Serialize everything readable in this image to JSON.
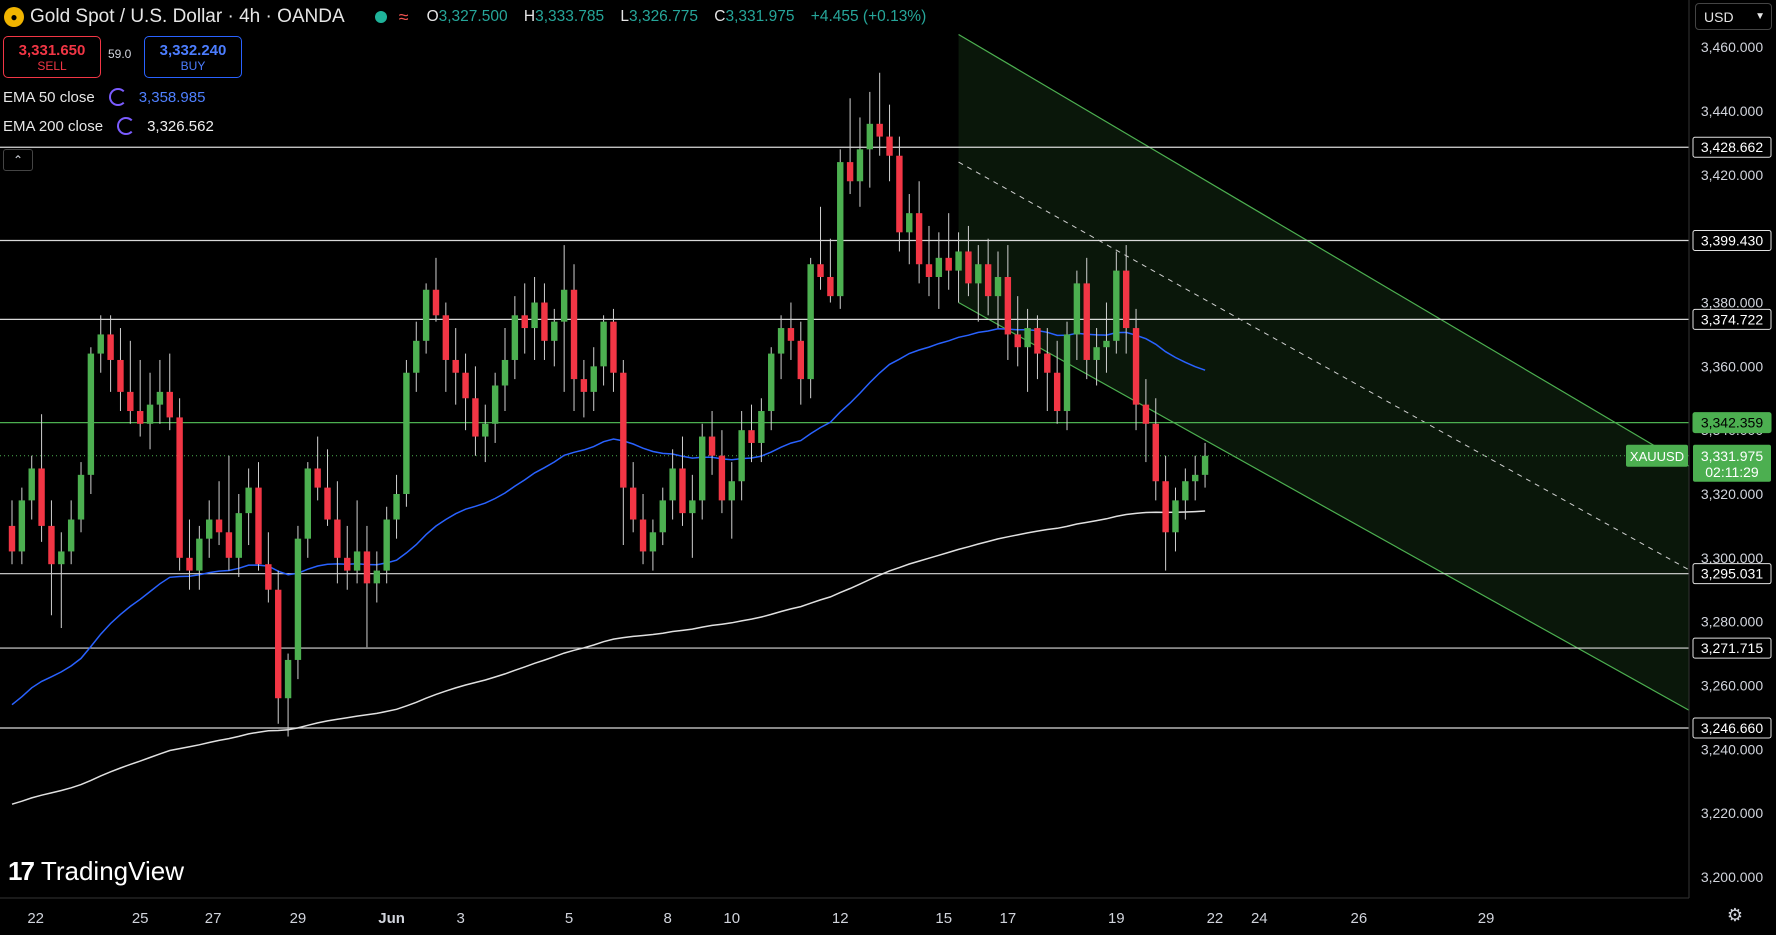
{
  "header": {
    "title": "Gold Spot / U.S. Dollar · 4h · OANDA",
    "ohlc": [
      {
        "key": "O",
        "value": "3,327.500"
      },
      {
        "key": "H",
        "value": "3,333.785"
      },
      {
        "key": "L",
        "value": "3,326.775"
      },
      {
        "key": "C",
        "value": "3,331.975"
      }
    ],
    "change": "+4.455 (+0.13%)"
  },
  "trade": {
    "sell_price": "3,331.650",
    "sell_label": "SELL",
    "spread": "59.0",
    "buy_price": "3,332.240",
    "buy_label": "BUY"
  },
  "indicators": [
    {
      "label": "EMA 50 close",
      "value": "3,358.985",
      "color": "#2962ff"
    },
    {
      "label": "EMA 200 close",
      "value": "3,326.562",
      "color": "#ffffff"
    }
  ],
  "currency": "USD",
  "brand": "TradingView",
  "colors": {
    "up": "#4caf50",
    "down": "#f23645",
    "channel": "#4caf50",
    "ema50": "#2962ff",
    "ema200": "#e0e0e0"
  },
  "chart_data": {
    "type": "candlestick",
    "ylim": [
      3193.4,
      3474.8
    ],
    "yticks": [
      "3,200.000",
      "3,220.000",
      "3,240.000",
      "3,260.000",
      "3,280.000",
      "3,300.000",
      "3,320.000",
      "3,340.000",
      "3,360.000",
      "3,380.000",
      "3,400.000",
      "3,420.000",
      "3,440.000",
      "3,460.000"
    ],
    "xticks": [
      "22",
      "25",
      "27",
      "29",
      "Jun",
      "3",
      "5",
      "8",
      "10",
      "12",
      "15",
      "17",
      "19",
      "22",
      "24",
      "26",
      "29"
    ],
    "horizontal_levels": [
      {
        "label": "3,428.662",
        "value": 3428.662
      },
      {
        "label": "3,399.430",
        "value": 3399.43
      },
      {
        "label": "3,374.722",
        "value": 3374.722
      },
      {
        "label": "3,342.359",
        "value": 3342.359,
        "highlight": true
      },
      {
        "label": "3,295.031",
        "value": 3295.031
      },
      {
        "label": "3,271.715",
        "value": 3271.715
      },
      {
        "label": "3,246.660",
        "value": 3246.66
      }
    ],
    "current_price": {
      "symbol": "XAUUSD",
      "value": 3331.975,
      "label": "3,331.975",
      "countdown": "02:11:29"
    },
    "channel": {
      "start_index": 96,
      "end_index": 165,
      "upper": [
        3464,
        3338
      ],
      "mid": [
        3424,
        3305
      ],
      "lower": [
        3380,
        3261
      ]
    },
    "candles": [
      [
        3310,
        3318,
        3298,
        3302
      ],
      [
        3302,
        3322,
        3298,
        3318
      ],
      [
        3318,
        3332,
        3312,
        3328
      ],
      [
        3328,
        3345,
        3305,
        3310
      ],
      [
        3310,
        3318,
        3282,
        3298
      ],
      [
        3298,
        3308,
        3278,
        3302
      ],
      [
        3302,
        3318,
        3298,
        3312
      ],
      [
        3312,
        3330,
        3308,
        3326
      ],
      [
        3326,
        3366,
        3320,
        3364
      ],
      [
        3364,
        3376,
        3358,
        3370
      ],
      [
        3370,
        3376,
        3352,
        3362
      ],
      [
        3362,
        3372,
        3346,
        3352
      ],
      [
        3352,
        3368,
        3342,
        3346
      ],
      [
        3346,
        3362,
        3338,
        3342
      ],
      [
        3342,
        3358,
        3334,
        3348
      ],
      [
        3348,
        3362,
        3342,
        3352
      ],
      [
        3352,
        3364,
        3340,
        3344
      ],
      [
        3344,
        3350,
        3296,
        3300
      ],
      [
        3300,
        3312,
        3290,
        3296
      ],
      [
        3296,
        3310,
        3290,
        3306
      ],
      [
        3306,
        3318,
        3300,
        3312
      ],
      [
        3312,
        3324,
        3304,
        3308
      ],
      [
        3308,
        3332,
        3296,
        3300
      ],
      [
        3300,
        3320,
        3294,
        3314
      ],
      [
        3314,
        3328,
        3304,
        3322
      ],
      [
        3322,
        3330,
        3296,
        3298
      ],
      [
        3298,
        3308,
        3286,
        3290
      ],
      [
        3290,
        3296,
        3248,
        3256
      ],
      [
        3256,
        3270,
        3244,
        3268
      ],
      [
        3268,
        3310,
        3262,
        3306
      ],
      [
        3306,
        3330,
        3300,
        3328
      ],
      [
        3328,
        3338,
        3318,
        3322
      ],
      [
        3322,
        3334,
        3310,
        3312
      ],
      [
        3312,
        3324,
        3292,
        3300
      ],
      [
        3300,
        3310,
        3290,
        3296
      ],
      [
        3296,
        3318,
        3292,
        3302
      ],
      [
        3302,
        3310,
        3272,
        3292
      ],
      [
        3292,
        3302,
        3286,
        3296
      ],
      [
        3296,
        3316,
        3292,
        3312
      ],
      [
        3312,
        3326,
        3306,
        3320
      ],
      [
        3320,
        3362,
        3316,
        3358
      ],
      [
        3358,
        3374,
        3352,
        3368
      ],
      [
        3368,
        3386,
        3364,
        3384
      ],
      [
        3384,
        3394,
        3374,
        3376
      ],
      [
        3376,
        3380,
        3352,
        3362
      ],
      [
        3362,
        3372,
        3348,
        3358
      ],
      [
        3358,
        3364,
        3340,
        3350
      ],
      [
        3350,
        3360,
        3332,
        3338
      ],
      [
        3338,
        3348,
        3330,
        3342
      ],
      [
        3342,
        3358,
        3336,
        3354
      ],
      [
        3354,
        3372,
        3346,
        3362
      ],
      [
        3362,
        3382,
        3356,
        3376
      ],
      [
        3376,
        3386,
        3364,
        3372
      ],
      [
        3372,
        3388,
        3362,
        3380
      ],
      [
        3380,
        3386,
        3362,
        3368
      ],
      [
        3368,
        3378,
        3360,
        3374
      ],
      [
        3374,
        3398,
        3352,
        3384
      ],
      [
        3384,
        3392,
        3346,
        3356
      ],
      [
        3356,
        3362,
        3344,
        3352
      ],
      [
        3352,
        3366,
        3346,
        3360
      ],
      [
        3360,
        3376,
        3354,
        3374
      ],
      [
        3374,
        3378,
        3352,
        3358
      ],
      [
        3358,
        3362,
        3304,
        3322
      ],
      [
        3322,
        3330,
        3308,
        3312
      ],
      [
        3312,
        3320,
        3298,
        3302
      ],
      [
        3302,
        3312,
        3296,
        3308
      ],
      [
        3308,
        3322,
        3304,
        3318
      ],
      [
        3318,
        3334,
        3312,
        3328
      ],
      [
        3328,
        3338,
        3310,
        3314
      ],
      [
        3314,
        3326,
        3300,
        3318
      ],
      [
        3318,
        3342,
        3312,
        3338
      ],
      [
        3338,
        3346,
        3326,
        3332
      ],
      [
        3332,
        3340,
        3314,
        3318
      ],
      [
        3318,
        3330,
        3306,
        3324
      ],
      [
        3324,
        3346,
        3318,
        3340
      ],
      [
        3340,
        3348,
        3330,
        3336
      ],
      [
        3336,
        3350,
        3330,
        3346
      ],
      [
        3346,
        3366,
        3340,
        3364
      ],
      [
        3364,
        3376,
        3356,
        3372
      ],
      [
        3372,
        3380,
        3362,
        3368
      ],
      [
        3368,
        3374,
        3348,
        3356
      ],
      [
        3356,
        3394,
        3350,
        3392
      ],
      [
        3392,
        3410,
        3384,
        3388
      ],
      [
        3388,
        3400,
        3380,
        3382
      ],
      [
        3382,
        3428,
        3378,
        3424
      ],
      [
        3424,
        3444,
        3414,
        3418
      ],
      [
        3418,
        3438,
        3410,
        3428
      ],
      [
        3428,
        3446,
        3416,
        3436
      ],
      [
        3436,
        3452,
        3426,
        3432
      ],
      [
        3432,
        3442,
        3418,
        3426
      ],
      [
        3426,
        3432,
        3396,
        3402
      ],
      [
        3402,
        3414,
        3392,
        3408
      ],
      [
        3408,
        3418,
        3386,
        3392
      ],
      [
        3392,
        3404,
        3382,
        3388
      ],
      [
        3388,
        3402,
        3378,
        3394
      ],
      [
        3394,
        3408,
        3384,
        3390
      ],
      [
        3390,
        3402,
        3380,
        3396
      ],
      [
        3396,
        3404,
        3382,
        3386
      ],
      [
        3386,
        3398,
        3374,
        3392
      ],
      [
        3392,
        3400,
        3376,
        3382
      ],
      [
        3382,
        3396,
        3372,
        3388
      ],
      [
        3388,
        3398,
        3362,
        3370
      ],
      [
        3370,
        3382,
        3360,
        3366
      ],
      [
        3366,
        3378,
        3352,
        3372
      ],
      [
        3372,
        3376,
        3356,
        3364
      ],
      [
        3364,
        3372,
        3346,
        3358
      ],
      [
        3358,
        3368,
        3342,
        3346
      ],
      [
        3346,
        3374,
        3340,
        3370
      ],
      [
        3370,
        3390,
        3362,
        3386
      ],
      [
        3386,
        3394,
        3356,
        3362
      ],
      [
        3362,
        3372,
        3354,
        3366
      ],
      [
        3366,
        3380,
        3358,
        3368
      ],
      [
        3368,
        3396,
        3364,
        3390
      ],
      [
        3390,
        3398,
        3364,
        3372
      ],
      [
        3372,
        3378,
        3340,
        3348
      ],
      [
        3348,
        3356,
        3330,
        3342
      ],
      [
        3342,
        3350,
        3318,
        3324
      ],
      [
        3324,
        3332,
        3296,
        3308
      ],
      [
        3308,
        3322,
        3302,
        3318
      ],
      [
        3318,
        3328,
        3312,
        3324
      ],
      [
        3324,
        3332,
        3318,
        3326
      ],
      [
        3326,
        3336,
        3322,
        3331.975
      ]
    ]
  }
}
